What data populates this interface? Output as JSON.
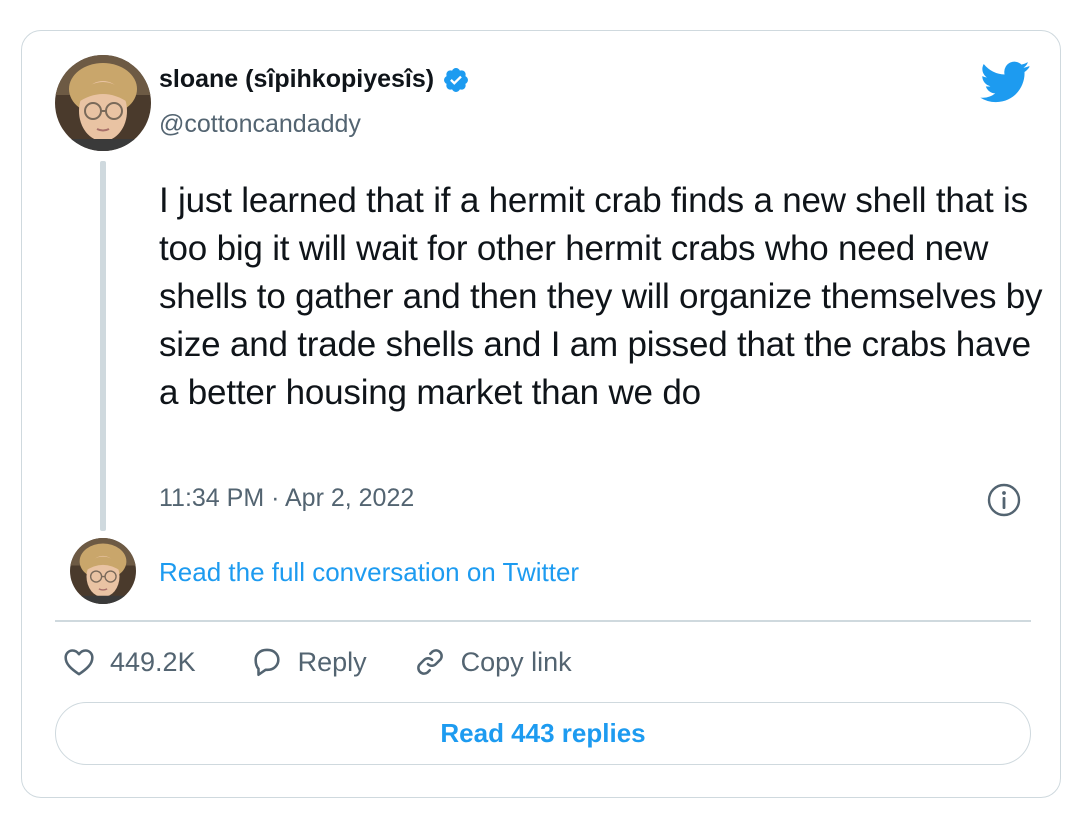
{
  "author": {
    "display_name": "sloane (sîpihkopiyesîs)",
    "handle": "@cottoncandaddy",
    "verified": true
  },
  "tweet": {
    "text": "I just learned that if a hermit crab finds a new shell that is too big it will wait for other hermit crabs who need new shells to gather and then they will organize themselves by size and trade shells and I am pissed that the crabs have a better housing market than we do",
    "timestamp": "11:34 PM · Apr 2, 2022"
  },
  "conversation": {
    "read_full_label": "Read the full conversation on Twitter"
  },
  "actions": {
    "like_count": "449.2K",
    "reply_label": "Reply",
    "copy_link_label": "Copy link"
  },
  "footer": {
    "read_replies_label": "Read 443 replies"
  },
  "icons": {
    "logo": "twitter-bird-icon",
    "verified": "verified-badge-icon",
    "info": "info-icon",
    "like": "heart-icon",
    "reply": "speech-bubble-icon",
    "copy_link": "link-icon"
  },
  "colors": {
    "accent": "#1d9bf0",
    "text_primary": "#0f1419",
    "text_secondary": "#536471",
    "border": "#cfd9de"
  }
}
